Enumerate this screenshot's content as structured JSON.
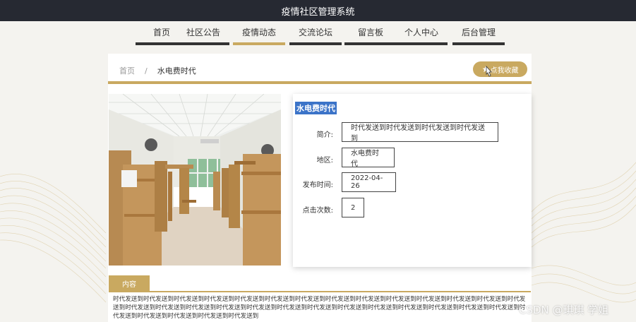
{
  "header": {
    "title": "疫情社区管理系统"
  },
  "nav": {
    "items": [
      {
        "label": "首页"
      },
      {
        "label": "社区公告"
      },
      {
        "label": "疫情动态"
      },
      {
        "label": "交流论坛"
      },
      {
        "label": "留言板"
      },
      {
        "label": "个人中心"
      },
      {
        "label": "后台管理"
      }
    ]
  },
  "breadcrumb": {
    "home": "首页",
    "separator": "/",
    "current": "水电费时代"
  },
  "favorite": {
    "label": "点我收藏",
    "icon": "star-icon"
  },
  "detail": {
    "title": "水电费时代",
    "rows": [
      {
        "label": "简介:",
        "value": "时代发送到时代发送到时代发送到时代发送到"
      },
      {
        "label": "地区:",
        "value": "水电费时代"
      },
      {
        "label": "发布时间:",
        "value": "2022-04-26"
      },
      {
        "label": "点击次数:",
        "value": "2"
      }
    ]
  },
  "content": {
    "tab_label": "内容",
    "text": "时代发送到时代发送到时代发送到时代发送到时代发送到时代发送到时代发送到时代发送到时代发送到时代发送到时代发送到时代发送到时代发送到时代发送到时代发送到时代发送到时代发送到时代发送到时代发送到时代发送到时代发送到时代发送到时代发送到时代发送到时代发送到时代发送到时代发送到时代发送到时代发送到时代发送到时代发送到时代发送到"
  },
  "watermark": "CSDN @琪琪 学姐",
  "colors": {
    "accent": "#c9a960",
    "header": "#262932",
    "title_highlight": "#3b73c8"
  }
}
